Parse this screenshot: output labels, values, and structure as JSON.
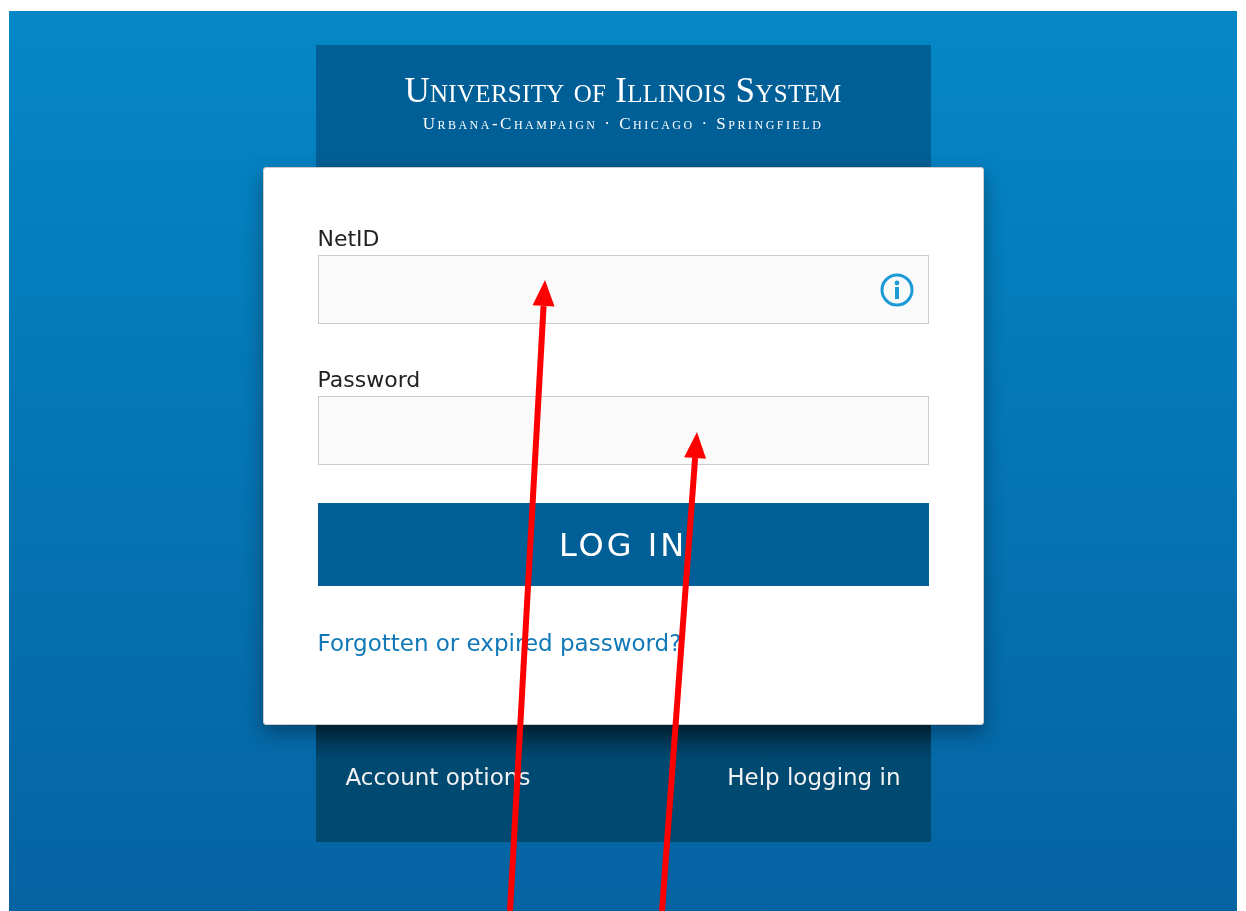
{
  "header": {
    "title": "University of Illinois System",
    "subtitle": "Urbana-Champaign · Chicago · Springfield"
  },
  "form": {
    "fields": [
      {
        "label": "NetID",
        "info_icon": true
      },
      {
        "label": "Password",
        "info_icon": false
      }
    ],
    "submit": "LOG IN",
    "link": "Forgotten or expired password?"
  },
  "footer": {
    "links": [
      "Account options",
      "Help logging in"
    ]
  }
}
